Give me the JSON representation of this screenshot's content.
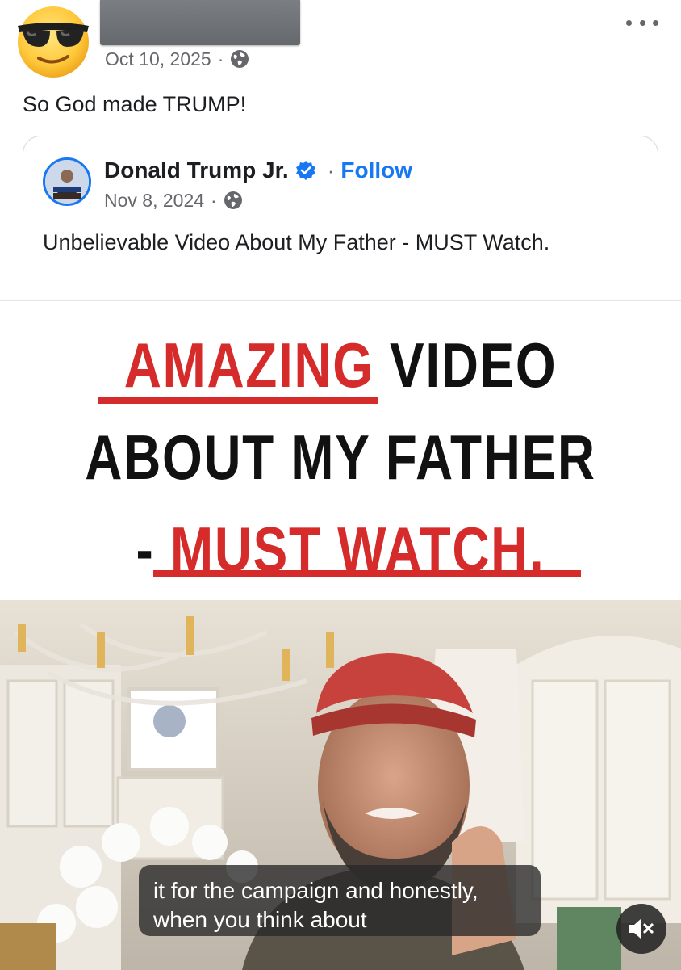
{
  "post": {
    "date": "Oct 10, 2025",
    "dot": "·",
    "text": "So God made TRUMP!",
    "avatar_icon": "sunglasses-emoji-avatar",
    "audience_icon": "globe-icon",
    "more_icon": "more-options-icon"
  },
  "shared_post": {
    "author": "Donald Trump Jr.",
    "verified_icon": "verified-badge-icon",
    "separator": "·",
    "follow_label": "Follow",
    "date": "Nov 8, 2024",
    "dot": "·",
    "text": "Unbelievable Video About My Father - MUST Watch.",
    "audience_icon": "globe-icon"
  },
  "media": {
    "headline": {
      "line1_red": "AMAZING",
      "line1_black": " VIDEO",
      "line2": "ABOUT MY FATHER",
      "line3_dash": "- ",
      "line3_red": "MUST WATCH."
    },
    "video": {
      "captions": "it for the campaign and honestly, when you think about",
      "mute_icon": "speaker-muted-icon"
    }
  },
  "colors": {
    "accent_blue": "#1877f2",
    "headline_red": "#d62b2b",
    "meta_gray": "#65676b"
  }
}
